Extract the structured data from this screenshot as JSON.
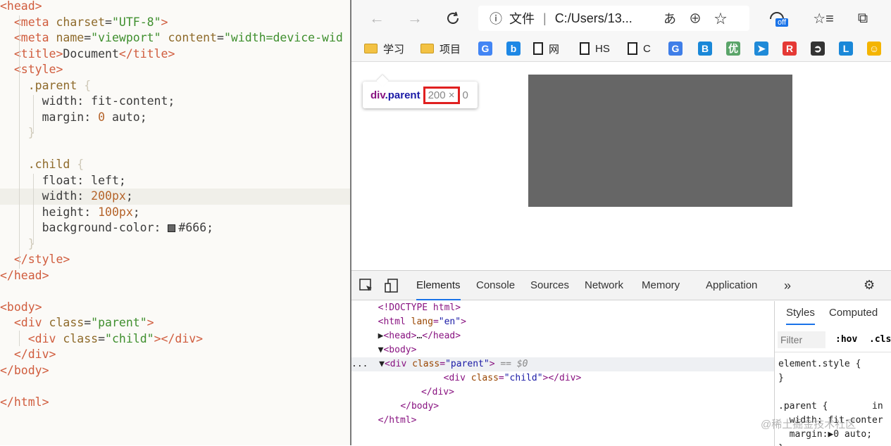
{
  "editor": {
    "lines": [
      {
        "parts": [
          [
            "t-tag",
            "<head>"
          ]
        ]
      },
      {
        "indent": "  ",
        "parts": [
          [
            "t-tag",
            "<meta "
          ],
          [
            "t-attr",
            "charset"
          ],
          [
            "t-plain",
            "="
          ],
          [
            "t-str",
            "\"UTF-8\""
          ],
          [
            "t-tag",
            ">"
          ]
        ]
      },
      {
        "indent": "  ",
        "parts": [
          [
            "t-tag",
            "<meta "
          ],
          [
            "t-attr",
            "name"
          ],
          [
            "t-plain",
            "="
          ],
          [
            "t-str",
            "\"viewport\""
          ],
          [
            "t-plain",
            " "
          ],
          [
            "t-attr",
            "content"
          ],
          [
            "t-plain",
            "="
          ],
          [
            "t-str",
            "\"width=device-wid"
          ]
        ]
      },
      {
        "indent": "  ",
        "parts": [
          [
            "t-tag",
            "<title>"
          ],
          [
            "t-plain",
            "Document"
          ],
          [
            "t-tag",
            "</title>"
          ]
        ]
      },
      {
        "indent": "  ",
        "parts": [
          [
            "t-tag",
            "<style>"
          ]
        ]
      },
      {
        "indent": "    ",
        "parts": [
          [
            "t-sel",
            ".parent "
          ],
          [
            "t-brace",
            "{"
          ]
        ]
      },
      {
        "indent": "      ",
        "parts": [
          [
            "t-prop",
            "width: fit-content;"
          ]
        ]
      },
      {
        "indent": "      ",
        "parts": [
          [
            "t-prop",
            "margin: "
          ],
          [
            "t-num",
            "0"
          ],
          [
            "t-prop",
            " auto;"
          ]
        ]
      },
      {
        "indent": "    ",
        "parts": [
          [
            "t-brace",
            "}"
          ]
        ]
      },
      {
        "parts": []
      },
      {
        "indent": "    ",
        "parts": [
          [
            "t-sel",
            ".child "
          ],
          [
            "t-brace",
            "{"
          ]
        ]
      },
      {
        "indent": "      ",
        "parts": [
          [
            "t-prop",
            "float: left;"
          ]
        ]
      },
      {
        "indent": "      ",
        "highlight": true,
        "parts": [
          [
            "t-prop",
            "width: "
          ],
          [
            "t-num",
            "200px"
          ],
          [
            "t-prop",
            ";"
          ]
        ]
      },
      {
        "indent": "      ",
        "parts": [
          [
            "t-prop",
            "height: "
          ],
          [
            "t-num",
            "100px"
          ],
          [
            "t-prop",
            ";"
          ]
        ]
      },
      {
        "indent": "      ",
        "swatch": true,
        "parts": [
          [
            "t-prop",
            "background-color: "
          ],
          [
            "t-hex",
            "#666"
          ],
          [
            "t-prop",
            ";"
          ]
        ]
      },
      {
        "indent": "    ",
        "parts": [
          [
            "t-brace",
            "}"
          ]
        ]
      },
      {
        "indent": "  ",
        "parts": [
          [
            "t-tag",
            "</style>"
          ]
        ]
      },
      {
        "parts": [
          [
            "t-tag",
            "</head>"
          ]
        ]
      },
      {
        "parts": []
      },
      {
        "parts": [
          [
            "t-tag",
            "<body>"
          ]
        ]
      },
      {
        "indent": "  ",
        "parts": [
          [
            "t-tag",
            "<div "
          ],
          [
            "t-attr",
            "class"
          ],
          [
            "t-plain",
            "="
          ],
          [
            "t-str",
            "\"parent\""
          ],
          [
            "t-tag",
            ">"
          ]
        ]
      },
      {
        "indent": "    ",
        "parts": [
          [
            "t-tag",
            "<div "
          ],
          [
            "t-attr",
            "class"
          ],
          [
            "t-plain",
            "="
          ],
          [
            "t-str",
            "\"child\""
          ],
          [
            "t-tag",
            "></div>"
          ]
        ]
      },
      {
        "indent": "  ",
        "parts": [
          [
            "t-tag",
            "</div>"
          ]
        ]
      },
      {
        "parts": [
          [
            "t-tag",
            "</body>"
          ]
        ]
      },
      {
        "parts": []
      },
      {
        "parts": [
          [
            "t-tag",
            "</html>"
          ]
        ]
      }
    ]
  },
  "browser": {
    "address": {
      "file_label": "文件",
      "url": "C:/Users/13..."
    },
    "extension_badge": "off",
    "bookmarks": [
      {
        "type": "folder",
        "label": "学习"
      },
      {
        "type": "folder",
        "label": "项目"
      },
      {
        "type": "fav",
        "label": "",
        "glyph": "G",
        "color": "#4285f4"
      },
      {
        "type": "fav",
        "label": "",
        "glyph": "b",
        "color": "#1e88e5"
      },
      {
        "type": "page",
        "label": "网"
      },
      {
        "type": "page",
        "label": "HS"
      },
      {
        "type": "page",
        "label": "C"
      },
      {
        "type": "fav",
        "label": "",
        "glyph": "G",
        "color": "#3f7ee8"
      },
      {
        "type": "fav",
        "label": "",
        "glyph": "B",
        "color": "#1a88d8"
      },
      {
        "type": "fav",
        "label": "",
        "glyph": "优",
        "color": "#5aa469"
      },
      {
        "type": "fav",
        "label": "",
        "glyph": "➤",
        "color": "#1f8ad8"
      },
      {
        "type": "fav",
        "label": "",
        "glyph": "R",
        "color": "#e53935"
      },
      {
        "type": "fav",
        "label": "",
        "glyph": "➲",
        "color": "#333333"
      },
      {
        "type": "fav",
        "label": "",
        "glyph": "L",
        "color": "#1a88d8"
      },
      {
        "type": "fav",
        "label": "",
        "glyph": "☺",
        "color": "#f4b400"
      }
    ],
    "tooltip": {
      "tag": "div",
      "cls": ".parent",
      "width": "200",
      "sep": " ×",
      "height": "0"
    },
    "box_color": "#666666"
  },
  "devtools": {
    "tabs": [
      "Elements",
      "Console",
      "Sources",
      "Network",
      "Memory",
      "Application"
    ],
    "more": "»",
    "dom": [
      {
        "prefix": "  ",
        "parts": [
          [
            "d-tag",
            "<!DOCTYPE html>"
          ]
        ]
      },
      {
        "prefix": "  ",
        "parts": [
          [
            "d-tag",
            "<html "
          ],
          [
            "d-attr",
            "lang"
          ],
          [
            "d-tag",
            "="
          ],
          [
            "d-val",
            "\"en\""
          ],
          [
            "d-tag",
            ">"
          ]
        ]
      },
      {
        "prefix": "  ▶",
        "parts": [
          [
            "d-tag",
            "<head>"
          ],
          [
            "d-txt",
            "…"
          ],
          [
            "d-tag",
            "</head>"
          ]
        ]
      },
      {
        "prefix": "  ▼",
        "parts": [
          [
            "d-tag",
            "<body>"
          ]
        ]
      },
      {
        "prefix": "...  ▼",
        "selected": true,
        "parts": [
          [
            "d-tag",
            "<div "
          ],
          [
            "d-attr",
            "class"
          ],
          [
            "d-tag",
            "="
          ],
          [
            "d-val",
            "\"parent\""
          ],
          [
            "d-tag",
            ">"
          ],
          [
            "d-eq",
            " == $0"
          ]
        ]
      },
      {
        "prefix": "        ",
        "parts": [
          [
            "d-tag",
            "<div "
          ],
          [
            "d-attr",
            "class"
          ],
          [
            "d-tag",
            "="
          ],
          [
            "d-val",
            "\"child\""
          ],
          [
            "d-tag",
            "></div>"
          ]
        ]
      },
      {
        "prefix": "      ",
        "parts": [
          [
            "d-tag",
            "</div>"
          ]
        ]
      },
      {
        "prefix": "    ",
        "parts": [
          [
            "d-tag",
            "</body>"
          ]
        ]
      },
      {
        "prefix": "  ",
        "parts": [
          [
            "d-tag",
            "</html>"
          ]
        ]
      }
    ],
    "styles": {
      "tabs": [
        "Styles",
        "Computed"
      ],
      "filter_placeholder": "Filter",
      "hov": ":hov",
      "cls": ".cls",
      "lines": [
        "element.style {",
        "}",
        "",
        ".parent {        in",
        "  width: fit-conter",
        "  margin:▶0 auto;",
        "}"
      ]
    }
  },
  "watermark": "@稀土掘金技术社区"
}
